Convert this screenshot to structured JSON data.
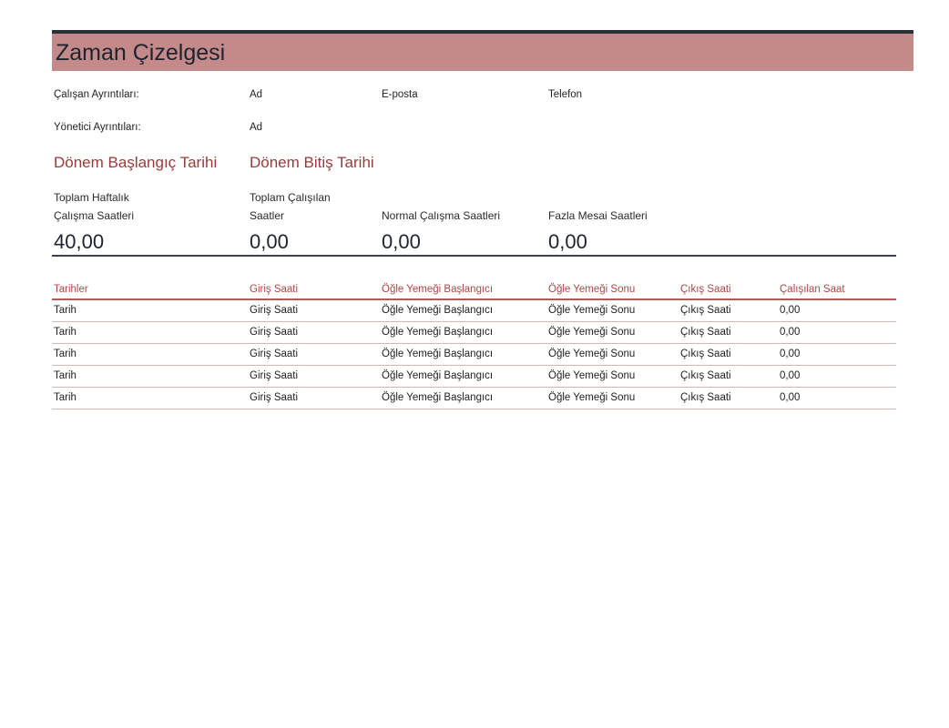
{
  "title": "Zaman Çizelgesi",
  "employee": {
    "label": "Çalışan Ayrıntıları:",
    "name_label": "Ad",
    "email_label": "E-posta",
    "phone_label": "Telefon"
  },
  "manager": {
    "label": "Yönetici Ayrıntıları:",
    "name_label": "Ad"
  },
  "period": {
    "start_label": "Dönem Başlangıç Tarihi",
    "end_label": "Dönem Bitiş Tarihi"
  },
  "summary": [
    {
      "label_line1": "Toplam Haftalık",
      "label_line2": "Çalışma Saatleri",
      "value": "40,00"
    },
    {
      "label_line1": "Toplam Çalışılan",
      "label_line2": "Saatler",
      "value": "0,00"
    },
    {
      "label_line1": "",
      "label_line2": "Normal Çalışma Saatleri",
      "value": "0,00"
    },
    {
      "label_line1": "",
      "label_line2": "Fazla Mesai Saatleri",
      "value": "0,00"
    }
  ],
  "table": {
    "columns": [
      "Tarihler",
      "Giriş Saati",
      "Öğle Yemeği Başlangıcı",
      "Öğle Yemeği Sonu",
      "Çıkış Saati",
      "Çalışılan Saat"
    ],
    "rows": [
      [
        "Tarih",
        "Giriş Saati",
        "Öğle Yemeği Başlangıcı",
        "Öğle Yemeği Sonu",
        "Çıkış Saati",
        "0,00"
      ],
      [
        "Tarih",
        "Giriş Saati",
        "Öğle Yemeği Başlangıcı",
        "Öğle Yemeği Sonu",
        "Çıkış Saati",
        "0,00"
      ],
      [
        "Tarih",
        "Giriş Saati",
        "Öğle Yemeği Başlangıcı",
        "Öğle Yemeği Sonu",
        "Çıkış Saati",
        "0,00"
      ],
      [
        "Tarih",
        "Giriş Saati",
        "Öğle Yemeği Başlangıcı",
        "Öğle Yemeği Sonu",
        "Çıkış Saati",
        "0,00"
      ],
      [
        "Tarih",
        "Giriş Saati",
        "Öğle Yemeği Başlangıcı",
        "Öğle Yemeği Sonu",
        "Çıkış Saati",
        "0,00"
      ]
    ]
  },
  "colors": {
    "title_band": "#c48a8a",
    "accent": "#b04545",
    "rule": "#3a4050"
  }
}
